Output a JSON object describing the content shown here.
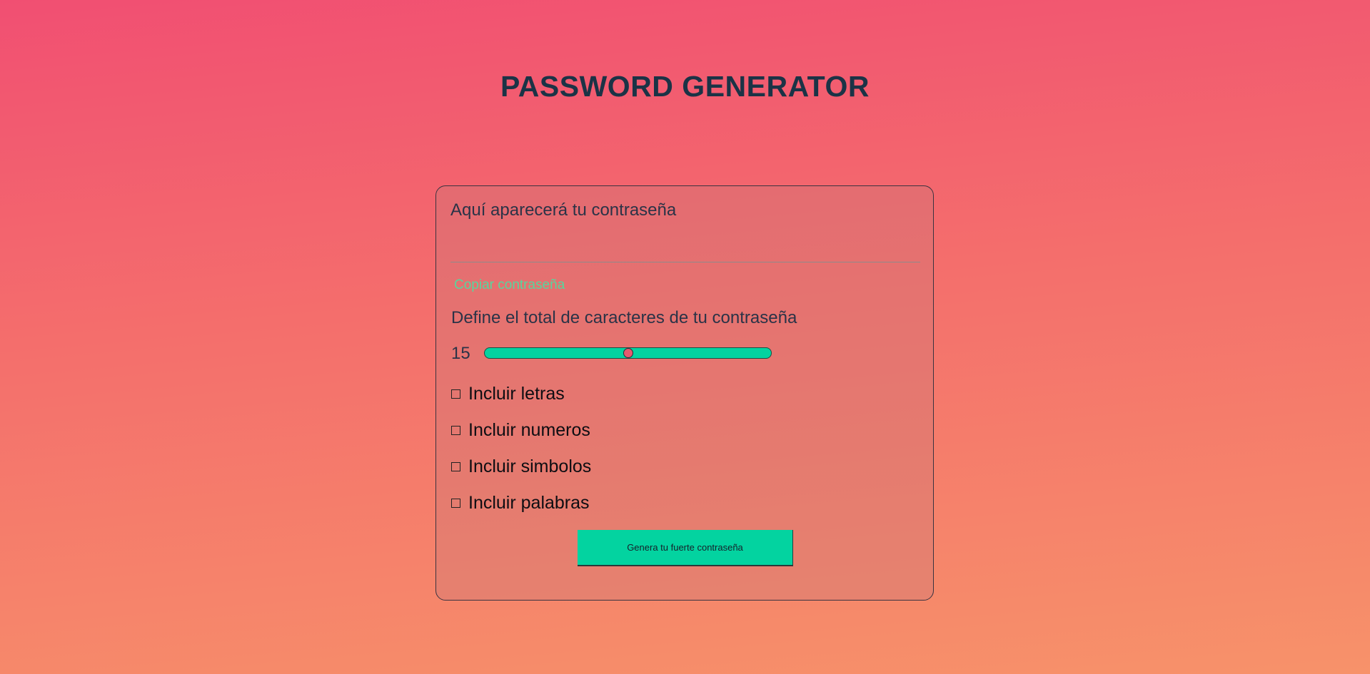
{
  "page": {
    "title": "PASSWORD GENERATOR"
  },
  "generator": {
    "output_placeholder": "Aquí aparecerá tu contraseña",
    "copy_label": "Copiar contraseña",
    "length_label": "Define el total de caracteres de tu contraseña",
    "length_value": "15",
    "length_fraction": 0.5,
    "options": [
      {
        "label": "Incluir letras",
        "checked": false
      },
      {
        "label": "Incluir numeros",
        "checked": false
      },
      {
        "label": "Incluir simbolos",
        "checked": false
      },
      {
        "label": "Incluir palabras",
        "checked": false
      }
    ],
    "generate_label": "Genera tu fuerte contraseña"
  },
  "colors": {
    "accent": "#03d3a0",
    "copy_text": "#57d69d",
    "title_text": "#1b3346",
    "thumb": "#e65a6e"
  },
  "icons": {
    "checkbox": "empty-square"
  }
}
